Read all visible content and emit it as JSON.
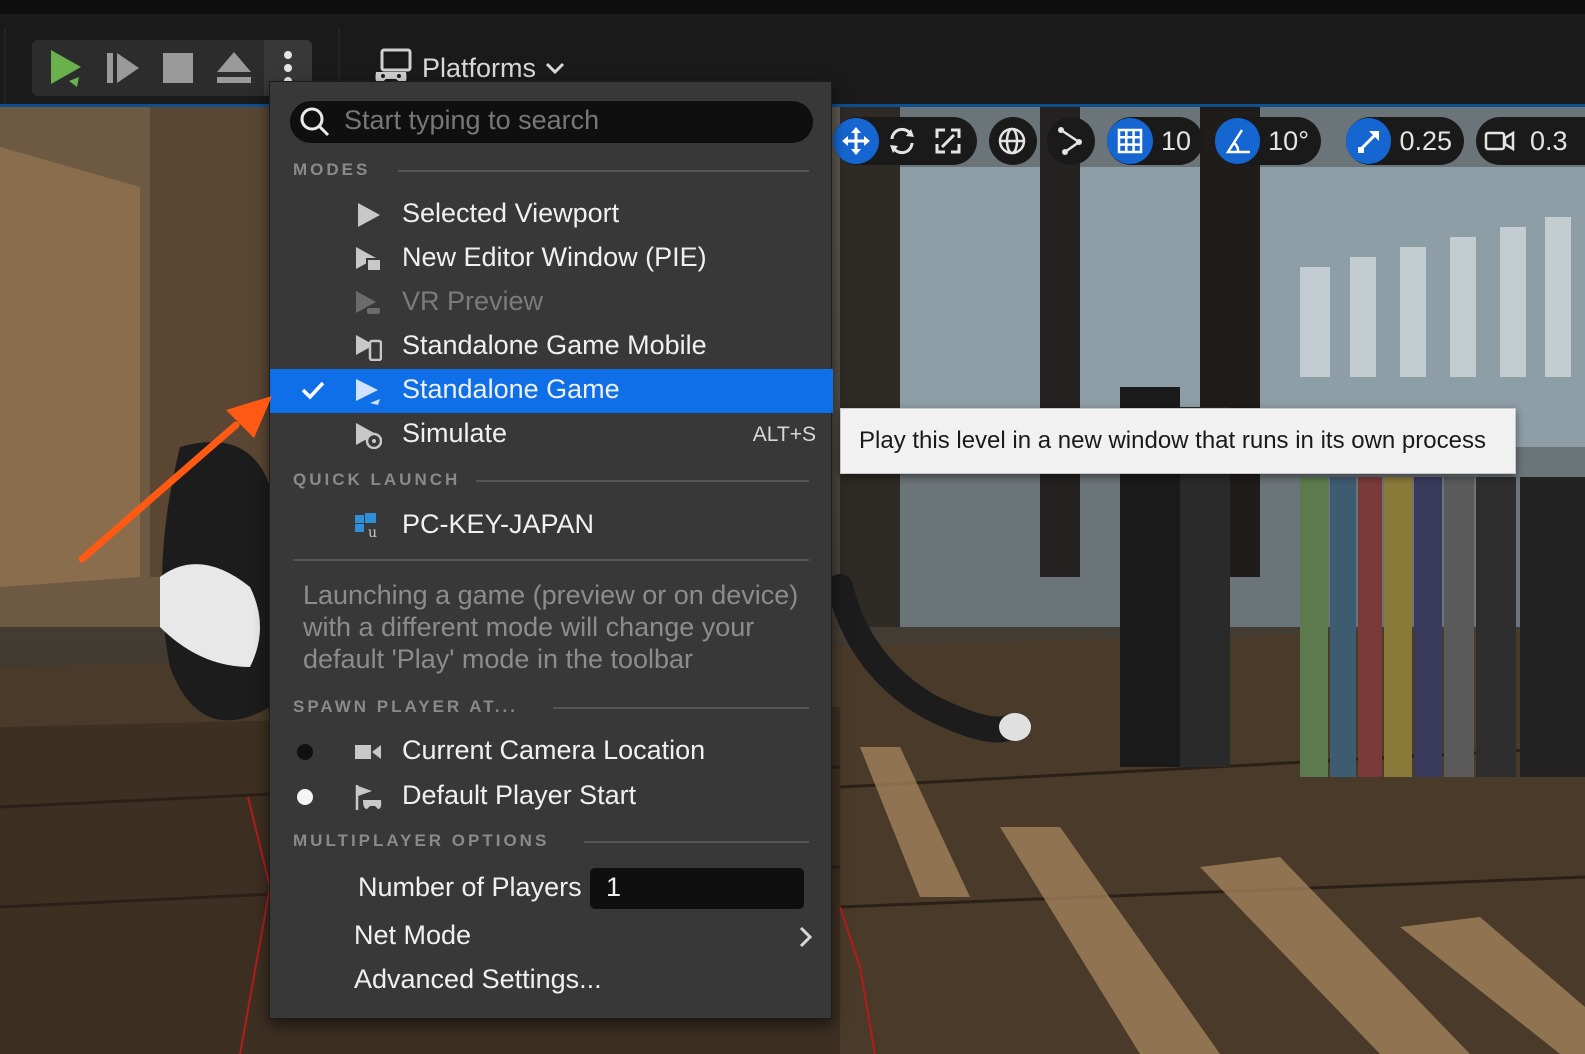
{
  "toolbar": {
    "buttons": [
      {
        "icon": "play-icon",
        "color": "#6ab04c"
      },
      {
        "icon": "step-forward-icon"
      },
      {
        "icon": "stop-icon"
      },
      {
        "icon": "eject-icon"
      },
      {
        "icon": "more-options-icon"
      }
    ],
    "platforms_label": "Platforms"
  },
  "viewport_toolbar": {
    "grid_snap": "10",
    "rotation_snap": "10°",
    "scale_snap": "0.25",
    "camera_speed": "0.3"
  },
  "menu": {
    "search_placeholder": "Start typing to search",
    "sections": {
      "modes": "MODES",
      "quick_launch": "QUICK LAUNCH",
      "spawn": "SPAWN PLAYER AT...",
      "multiplayer": "MULTIPLAYER OPTIONS"
    },
    "modes": [
      {
        "label": "Selected Viewport",
        "icon": "play-icon"
      },
      {
        "label": "New Editor Window (PIE)",
        "icon": "play-window-icon"
      },
      {
        "label": "VR Preview",
        "icon": "vr-preview-icon",
        "disabled": true
      },
      {
        "label": "Standalone Game Mobile",
        "icon": "mobile-icon"
      },
      {
        "label": "Standalone Game",
        "icon": "standalone-icon",
        "selected": true
      },
      {
        "label": "Simulate",
        "icon": "simulate-icon",
        "shortcut": "ALT+S"
      }
    ],
    "quick_launch": [
      {
        "label": "PC-KEY-JAPAN",
        "icon": "windows-unreal-icon"
      }
    ],
    "hint": "Launching a game (preview or on device) with a different mode will change your default 'Play' mode in the toolbar",
    "spawn": [
      {
        "label": "Current Camera Location",
        "icon": "camera-icon",
        "radio": "#111111"
      },
      {
        "label": "Default Player Start",
        "icon": "player-start-icon",
        "radio": "#f5f5f5"
      }
    ],
    "multiplayer": {
      "number_of_players_label": "Number of Players",
      "number_of_players_value": "1",
      "net_mode_label": "Net Mode",
      "advanced_settings_label": "Advanced Settings..."
    }
  },
  "tooltip": "Play this level in a new window that runs in its own process",
  "colors": {
    "accent_blue": "#0f6fe8",
    "arrow": "#ff5a14",
    "menu_bg": "#383838"
  }
}
